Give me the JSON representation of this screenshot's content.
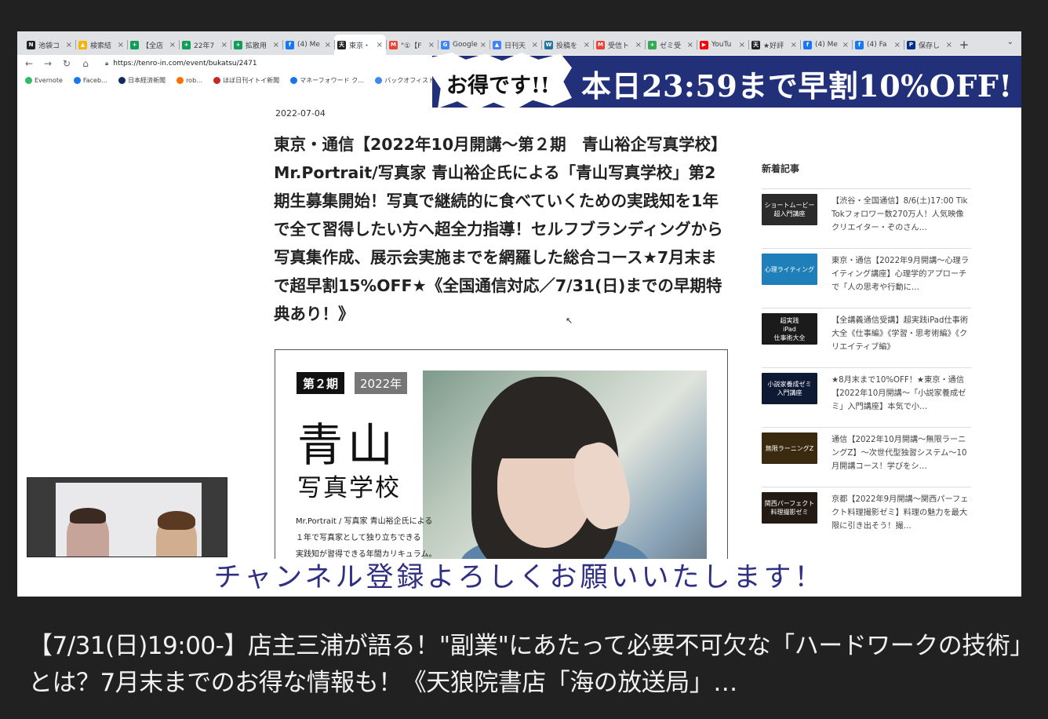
{
  "browser": {
    "tabs": [
      {
        "label": "池袋コ",
        "icon": "notion-icon",
        "color": "#222222",
        "glyph": "N"
      },
      {
        "label": "検索結",
        "icon": "drive-icon",
        "color": "#f4b400",
        "glyph": "▲"
      },
      {
        "label": "【全店",
        "icon": "sheets-icon",
        "color": "#0f9d58",
        "glyph": "+"
      },
      {
        "label": "22年7",
        "icon": "sheets-icon",
        "color": "#0f9d58",
        "glyph": "+"
      },
      {
        "label": "拡散用",
        "icon": "sheets-icon",
        "color": "#0f9d58",
        "glyph": "+"
      },
      {
        "label": "(4) Me",
        "icon": "facebook-icon",
        "color": "#1877f2",
        "glyph": "f"
      },
      {
        "label": "東京・",
        "icon": "tenro-icon",
        "color": "#222222",
        "glyph": "天",
        "active": true
      },
      {
        "label": "\"①【F",
        "icon": "gmail-icon",
        "color": "#ea4335",
        "glyph": "M"
      },
      {
        "label": "Google",
        "icon": "search-console-icon",
        "color": "#4285f4",
        "glyph": "G"
      },
      {
        "label": "日刊天",
        "icon": "drive-icon",
        "color": "#4285f4",
        "glyph": "▲"
      },
      {
        "label": "投稿を",
        "icon": "wordpress-icon",
        "color": "#21759b",
        "glyph": "W"
      },
      {
        "label": "受信ト",
        "icon": "gmail-icon",
        "color": "#ea4335",
        "glyph": "M"
      },
      {
        "label": "ゼミ受",
        "icon": "sheets-icon",
        "color": "#34a853",
        "glyph": "+"
      },
      {
        "label": "YouTu",
        "icon": "youtube-icon",
        "color": "#ff0000",
        "glyph": "▶"
      },
      {
        "label": "★好評",
        "icon": "tenro-icon",
        "color": "#222222",
        "glyph": "天"
      },
      {
        "label": "(4) Me",
        "icon": "facebook-icon",
        "color": "#1877f2",
        "glyph": "f"
      },
      {
        "label": "(4) Fa",
        "icon": "facebook-icon",
        "color": "#1877f2",
        "glyph": "f"
      },
      {
        "label": "保存し",
        "icon": "paypal-icon",
        "color": "#003087",
        "glyph": "P"
      }
    ],
    "new_tab": "+",
    "tab_menu": "⌄",
    "url": "https://tenro-in.com/event/bukatsu/2471",
    "bookmarks": [
      {
        "label": "Evernote",
        "color": "#2dbe60"
      },
      {
        "label": "Faceb…",
        "color": "#1877f2"
      },
      {
        "label": "日本経済新聞",
        "color": "#0f2a5c"
      },
      {
        "label": "rob…",
        "color": "#ff6f00"
      },
      {
        "label": "ほぼ日刊イトイ新聞",
        "color": "#c62828"
      },
      {
        "label": "マネーフォワード ク…",
        "color": "#1a73e8"
      },
      {
        "label": "バックオフィスト…",
        "color": "#4285f4"
      }
    ]
  },
  "sale_banner": {
    "burst_text": "お得です!!",
    "main_text": "本日23:59まで早割10%OFF!"
  },
  "article": {
    "date": "2022-07-04",
    "title": "東京・通信【2022年10月開講〜第２期　青山裕企写真学校】Mr.Portrait/写真家 青山裕企氏による「青山写真学校」第2期生募集開始！写真で継続的に食べていくための実践知を1年で全て習得したい方へ超全力指導！セルフブランディングから写真集作成、展示会実施までを網羅した総合コース★7月末まで超早割15%OFF★《全国通信対応／7/31(日)までの早期特典あり！》"
  },
  "hero": {
    "badge": "第２期",
    "year": "2022年",
    "title": "青山",
    "subtitle": "写真学校",
    "desc_lines": [
      "Mr.Portrait / 写真家 青山裕企氏による",
      "１年で写真家として独り立ちできる",
      "実践知が習得できる年間カリキュラム。"
    ]
  },
  "sidebar": {
    "heading": "新着記事",
    "items": [
      {
        "text": "【渋谷・全国通信】8/6(土)17:00 Tik Tokフォロワー数270万人！人気映像クリエイター・ぞのさん…",
        "thumb_label": "ショートムービー\n超入門講座",
        "thumb_color": "#2b2b2b"
      },
      {
        "text": "東京・通信【2022年9月開講〜心理ライティング講座】心理学的アプローチで「人の思考や行動に…",
        "thumb_label": "心理ライティング",
        "thumb_color": "#1f7fb8"
      },
      {
        "text": "【全講義通信受講】超実践iPad仕事術大全《仕事編》《学習・思考術編》《クリエイティブ編》",
        "thumb_label": "超実践\niPad\n仕事術大全",
        "thumb_color": "#1b1b1b"
      },
      {
        "text": "★8月末まで10%OFF！★東京・通信【2022年10月開講〜「小説家養成ゼミ」入門講座】本気で小…",
        "thumb_label": "小説家養成ゼミ\n入門講座",
        "thumb_color": "#0e1a33"
      },
      {
        "text": "通信【2022年10月開講〜無限ラーニングZ】〜次世代型独習システム〜10月開講コース！学びをシ…",
        "thumb_label": "無限ラーニングZ",
        "thumb_color": "#3a2a10"
      },
      {
        "text": "京都【2022年9月開講〜関西パーフェクト料理撮影ゼミ】料理の魅力を最大限に引き出そう！撮…",
        "thumb_label": "関西パーフェクト\n料理撮影ゼミ",
        "thumb_color": "#241a14"
      }
    ]
  },
  "channel_caption": "チャンネル登録よろしくお願いいたします！",
  "video_title": "【7/31(日)19:00-】店主三浦が語る！\"副業\"にあたって必要不可欠な「ハードワークの技術」とは？7月末までのお得な情報も！《天狼院書店「海の放送局」…"
}
